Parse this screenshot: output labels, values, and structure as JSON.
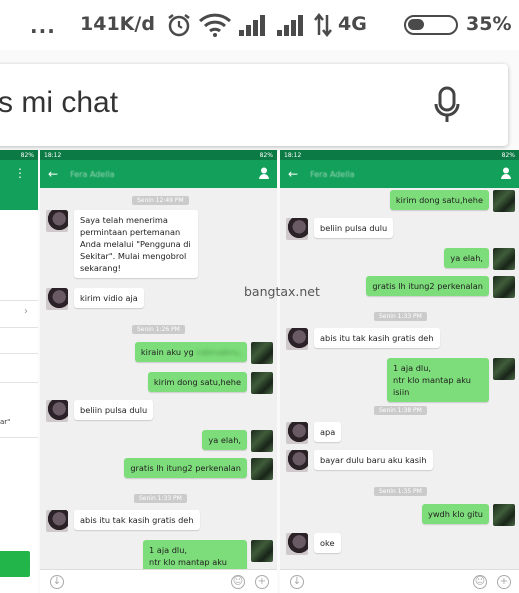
{
  "status_bar": {
    "dots": "...",
    "speed": "141K/d",
    "network": "4G",
    "battery_pct": "35%",
    "battery_level": 0.35
  },
  "search": {
    "query": "s mi chat",
    "mic_icon": "mic-icon"
  },
  "watermark": "bangtax.net",
  "panel_left": {
    "status_pct": "82%",
    "text_ar": "ar\""
  },
  "panel_mid": {
    "time": "18:12",
    "status_pct": "82%",
    "contact": "Fera Adella",
    "ts1": "Senin 12:49 PM",
    "ts2": "Senin 1:26 PM",
    "ts3": "Senin 1:33 PM",
    "messages": [
      {
        "dir": "in",
        "text": "Saya telah menerima permintaan pertemanan Anda melalui \"Pengguna di Sekitar\". Mulai mengobrol sekarang!"
      },
      {
        "dir": "in",
        "text": "kirim vidio aja"
      },
      {
        "dir": "out",
        "text": "kirain aku yg",
        "blurred": "cabruabru,"
      },
      {
        "dir": "out",
        "text": "kirim dong satu,hehe"
      },
      {
        "dir": "in",
        "text": "beliin pulsa dulu"
      },
      {
        "dir": "out",
        "text": "ya elah,"
      },
      {
        "dir": "out",
        "text": "gratis lh itung2 perkenalan"
      },
      {
        "dir": "in",
        "text": "abis itu tak kasih gratis deh"
      },
      {
        "dir": "out",
        "text": "1 aja dlu,"
      },
      {
        "dir": "out",
        "text": "ntr klo mantap aku isiin"
      }
    ]
  },
  "panel_right": {
    "time": "18:12",
    "status_pct": "82%",
    "contact": "Fera Adella",
    "ts1": "Senin 1:33 PM",
    "ts2": "Senin 1:38 PM",
    "ts3": "Senin 1:35 PM",
    "messages": [
      {
        "dir": "out",
        "text": "kirim dong satu,hehe"
      },
      {
        "dir": "in",
        "text": "beliin pulsa dulu"
      },
      {
        "dir": "out",
        "text": "ya elah,"
      },
      {
        "dir": "out",
        "text": "gratis lh itung2 perkenalan"
      },
      {
        "dir": "in",
        "text": "abis itu tak kasih gratis deh"
      },
      {
        "dir": "out",
        "text": "1 aja dlu,\nntr klo mantap aku isiin"
      },
      {
        "dir": "in",
        "text": "apa"
      },
      {
        "dir": "in",
        "text": "bayar dulu baru aku kasih"
      },
      {
        "dir": "out",
        "text": "ywdh klo gitu"
      },
      {
        "dir": "in",
        "text": "oke"
      }
    ]
  },
  "colors": {
    "accent": "#13a05a",
    "bubble_out": "#7ddd7a"
  }
}
